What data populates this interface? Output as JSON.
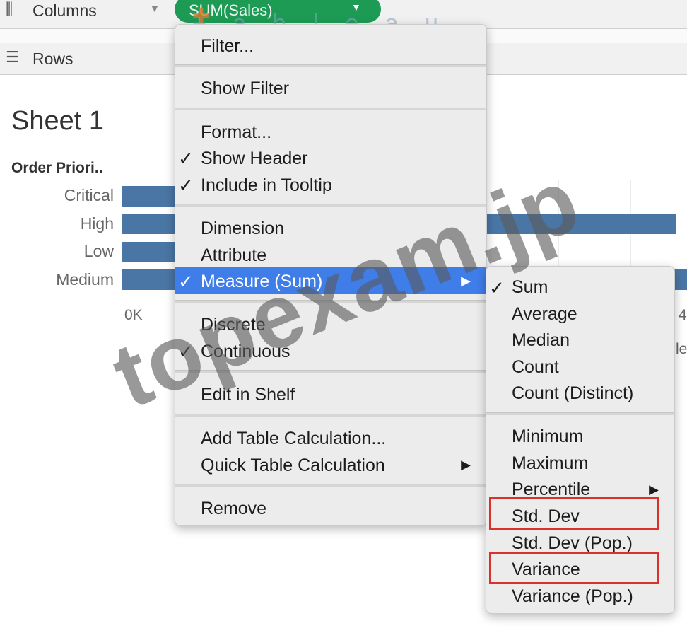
{
  "shelves": {
    "columns_label": "Columns",
    "columns_icon": "columns-icon",
    "rows_label": "Rows",
    "rows_icon": "rows-icon",
    "pill_label": "SUM(Sales)"
  },
  "logo_text": "+ a b | e a u",
  "sheet": {
    "title": "Sheet 1",
    "dimension_header": "Order Priori..",
    "rows": [
      "Critical",
      "High",
      "Low",
      "Medium"
    ],
    "axis_ticks": [
      "0K",
      "4"
    ],
    "axis_label_fragment": "le"
  },
  "chart_data": {
    "type": "bar",
    "orientation": "horizontal",
    "categories": [
      "Critical",
      "High",
      "Low",
      "Medium"
    ],
    "values": [
      null,
      null,
      null,
      null
    ],
    "xlabel": "",
    "ylabel": "Order Priori..",
    "bar_color": "#4a76a6"
  },
  "context_menu": {
    "items": [
      {
        "label": "Filter...",
        "checked": false
      },
      {
        "label": "Show Filter",
        "checked": false
      },
      {
        "label": "Format...",
        "checked": false
      },
      {
        "label": "Show Header",
        "checked": true
      },
      {
        "label": "Include in Tooltip",
        "checked": true
      },
      {
        "label": "Dimension",
        "checked": false
      },
      {
        "label": "Attribute",
        "checked": false
      },
      {
        "label": "Measure (Sum)",
        "checked": true,
        "submenu": true,
        "highlighted": true
      },
      {
        "label": "Discrete",
        "checked": false
      },
      {
        "label": "Continuous",
        "checked": true
      },
      {
        "label": "Edit in Shelf",
        "checked": false
      },
      {
        "label": "Add Table Calculation...",
        "checked": false
      },
      {
        "label": "Quick Table Calculation",
        "checked": false,
        "submenu": true
      },
      {
        "label": "Remove",
        "checked": false
      }
    ]
  },
  "measure_submenu": {
    "items": [
      {
        "label": "Sum",
        "checked": true
      },
      {
        "label": "Average",
        "checked": false
      },
      {
        "label": "Median",
        "checked": false
      },
      {
        "label": "Count",
        "checked": false
      },
      {
        "label": "Count (Distinct)",
        "checked": false
      },
      {
        "label": "Minimum",
        "checked": false
      },
      {
        "label": "Maximum",
        "checked": false
      },
      {
        "label": "Percentile",
        "checked": false,
        "submenu": true
      },
      {
        "label": "Std. Dev",
        "checked": false,
        "boxed": true
      },
      {
        "label": "Std. Dev (Pop.)",
        "checked": false
      },
      {
        "label": "Variance",
        "checked": false,
        "boxed": true
      },
      {
        "label": "Variance (Pop.)",
        "checked": false
      }
    ]
  },
  "glyphs": {
    "check": "✓",
    "arrow": "▶"
  },
  "colors": {
    "pill_green": "#1d9b55",
    "highlight_blue": "#3f7de9",
    "annotation_red": "#d9322b",
    "bar_blue": "#4a76a6"
  },
  "watermark": "topexam.jp"
}
